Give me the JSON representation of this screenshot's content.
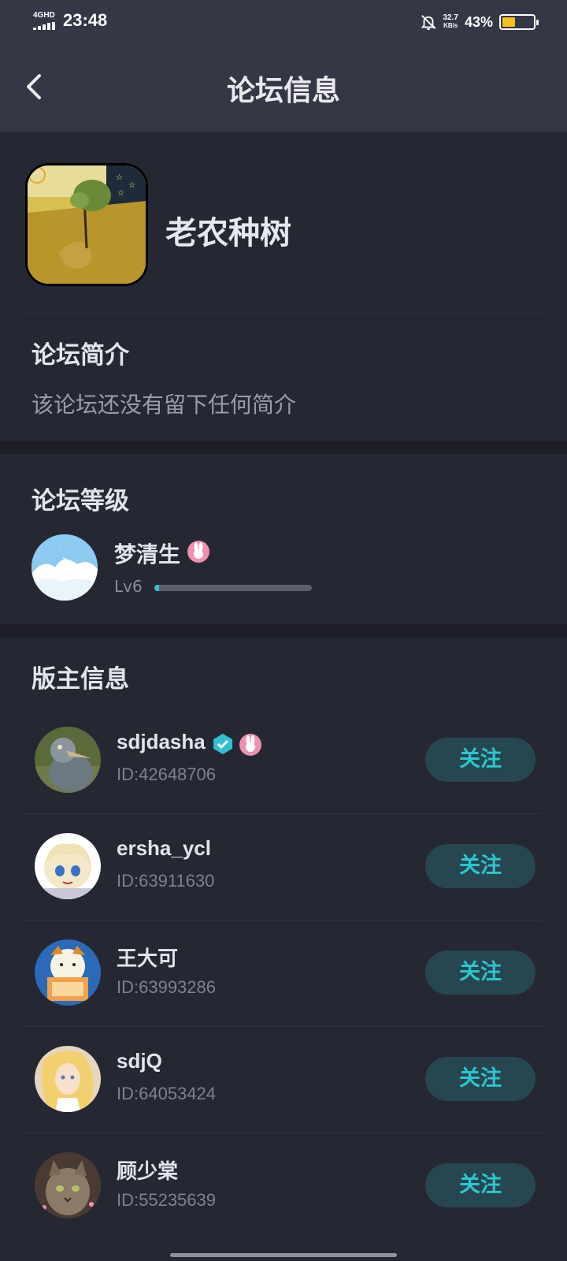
{
  "status_bar": {
    "network": "4GHD",
    "time": "23:48",
    "speed_value": "32.7",
    "speed_unit": "KB/s",
    "battery_percent": "43%",
    "battery_level": 0.43
  },
  "header": {
    "title": "论坛信息"
  },
  "forum": {
    "name": "老农种树"
  },
  "intro": {
    "title": "论坛简介",
    "text": "该论坛还没有留下任何简介"
  },
  "level": {
    "title": "论坛等级",
    "user_name": "梦清生",
    "level_label": "Lv6",
    "progress": 0.01
  },
  "moderators": {
    "title": "版主信息",
    "follow_label": "关注",
    "items": [
      {
        "name": "sdjdasha",
        "id": "ID:42648706"
      },
      {
        "name": "ersha_ycl",
        "id": "ID:63911630"
      },
      {
        "name": "王大可",
        "id": "ID:63993286"
      },
      {
        "name": "sdjQ",
        "id": "ID:64053424"
      },
      {
        "name": "顾少棠",
        "id": "ID:55235639"
      }
    ]
  },
  "colors": {
    "background": "#252733",
    "header": "#343745",
    "accent": "#2cc6cf",
    "button_bg": "#264750"
  }
}
